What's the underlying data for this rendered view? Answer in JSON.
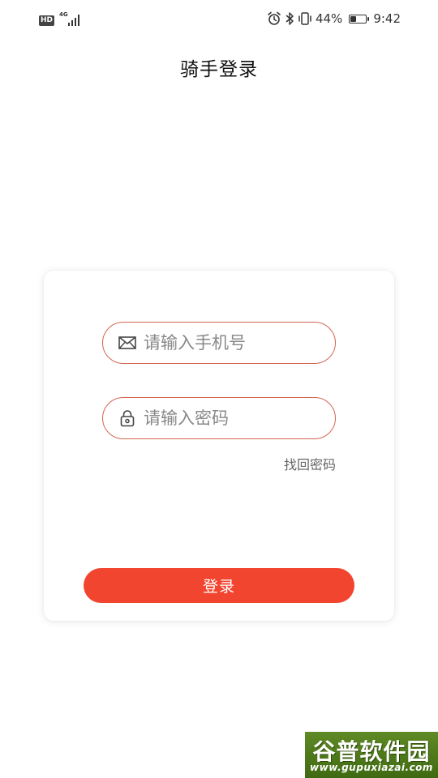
{
  "status_bar": {
    "hd": "HD",
    "network": "4G",
    "battery_percent": "44%",
    "battery_level": 0.44,
    "time": "9:42",
    "icons": [
      "alarm-icon",
      "bluetooth-icon",
      "vibrate-icon",
      "battery-icon"
    ]
  },
  "header": {
    "title": "骑手登录"
  },
  "login_form": {
    "phone_placeholder": "请输入手机号",
    "password_placeholder": "请输入密码",
    "forgot_password": "找回密码",
    "submit_label": "登录",
    "phone_icon": "mail-icon",
    "password_icon": "lock-icon"
  },
  "watermark": {
    "title": "谷普软件园",
    "url": "www.gupuxiazai.com"
  },
  "colors": {
    "accent": "#f2452f",
    "input_border": "#d3654f",
    "watermark_bg": "#4f7a1c"
  }
}
